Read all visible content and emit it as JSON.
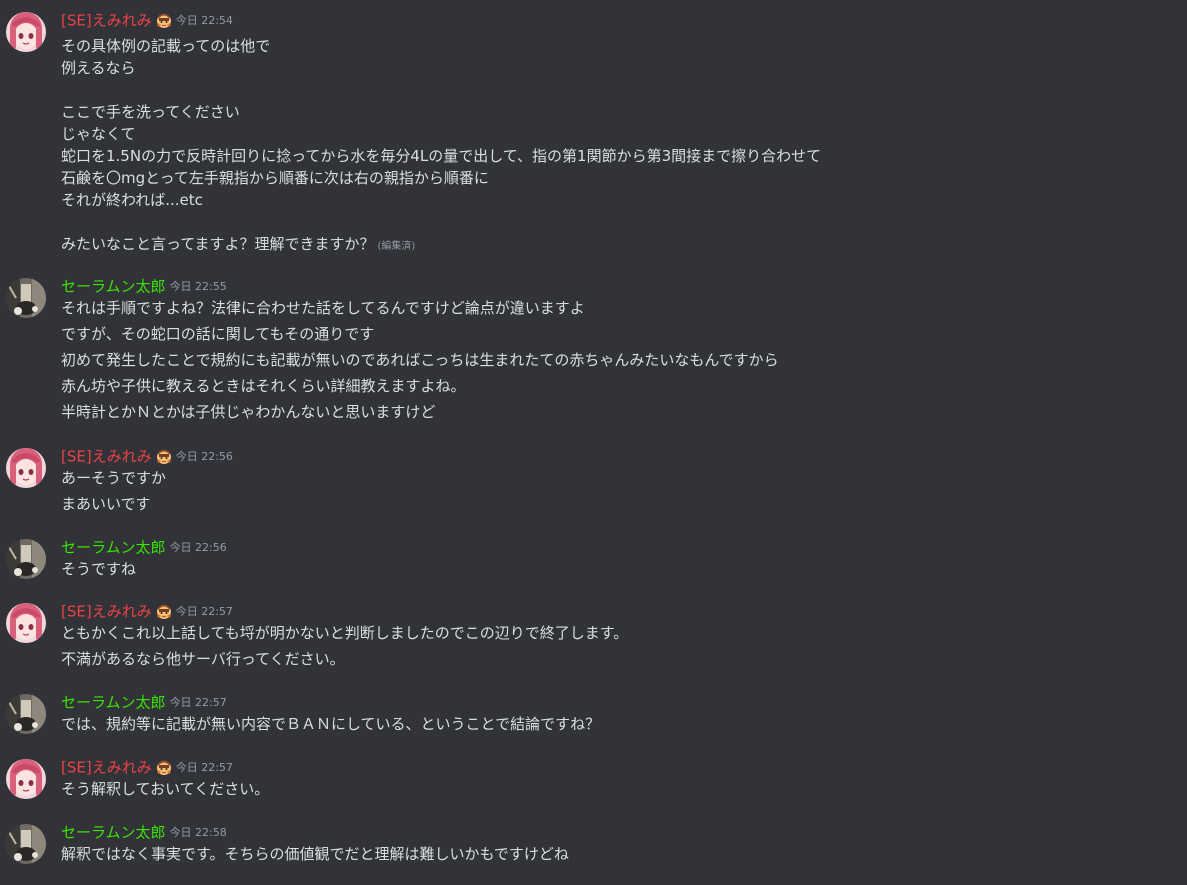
{
  "colors": {
    "background": "#313338",
    "text": "#dbdee1",
    "timestamp": "#949ba4",
    "user_emi": "#ed4245",
    "user_sailor": "#3ae500"
  },
  "users": {
    "emi": {
      "name": "[SE]えみれみ",
      "avatar_icon": "anime-girl-pink-hair-avatar",
      "badge_icon": "character-badge-icon"
    },
    "sailor": {
      "name": "セーラムン太郎",
      "avatar_icon": "photo-avatar"
    }
  },
  "messages": [
    {
      "user": "emi",
      "timestamp": "今日 22:54",
      "lines": [
        "その具体例の記載ってのは他で",
        "例えるなら",
        "",
        "ここで手を洗ってください",
        "じゃなくて",
        "蛇口を1.5Nの力で反時計回りに捻ってから水を毎分4Lの量で出して、指の第1関節から第3間接まで擦り合わせて",
        "石鹸を〇mgとって左手親指から順番に次は右の親指から順番に",
        "それが終われば...etc",
        "",
        "みたいなこと言ってますよ？理解できますか？"
      ],
      "edited": "(編集済)"
    },
    {
      "user": "sailor",
      "timestamp": "今日 22:55",
      "lines": [
        "それは手順ですよね？法律に合わせた話をしてるんですけど論点が違いますよ",
        "ですが、その蛇口の話に関してもその通りです",
        "初めて発生したことで規約にも記載が無いのであればこっちは生まれたての赤ちゃんみたいなもんですから",
        "赤ん坊や子供に教えるときはそれくらい詳細教えますよね。",
        "半時計とかＮとかは子供じゃわかんないと思いますけど"
      ]
    },
    {
      "user": "emi",
      "timestamp": "今日 22:56",
      "lines": [
        "あーそうですか",
        "まあいいです"
      ]
    },
    {
      "user": "sailor",
      "timestamp": "今日 22:56",
      "lines": [
        "そうですね"
      ]
    },
    {
      "user": "emi",
      "timestamp": "今日 22:57",
      "lines": [
        "ともかくこれ以上話しても埒が明かないと判断しましたのでこの辺りで終了します。",
        "不満があるなら他サーバ行ってください。"
      ]
    },
    {
      "user": "sailor",
      "timestamp": "今日 22:57",
      "lines": [
        "では、規約等に記載が無い内容でＢＡＮにしている、ということで結論ですね？"
      ]
    },
    {
      "user": "emi",
      "timestamp": "今日 22:57",
      "lines": [
        "そう解釈しておいてください。"
      ]
    },
    {
      "user": "sailor",
      "timestamp": "今日 22:58",
      "lines": [
        "解釈ではなく事実です。そちらの価値観でだと理解は難しいかもですけどね"
      ]
    }
  ]
}
